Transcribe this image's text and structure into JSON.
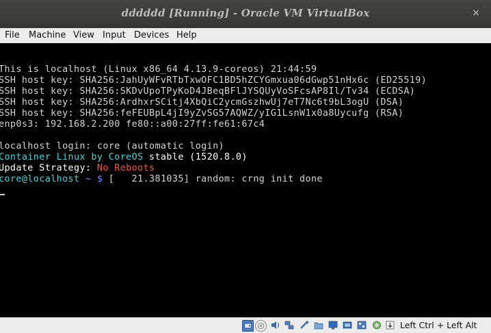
{
  "window": {
    "title": "dddddd [Running] - Oracle VM VirtualBox",
    "close_glyph": "×"
  },
  "menu": {
    "items": [
      "File",
      "Machine",
      "View",
      "Input",
      "Devices",
      "Help"
    ]
  },
  "console": {
    "l1": "This is localhost (Linux x86_64 4.13.9-coreos) 21:44:59",
    "l2": "SSH host key: SHA256:JahUyWFvRTbTxwOFC1BD5hZCYGmxua06dGwp51nHx6c (ED25519)",
    "l3": "SSH host key: SHA256:SKDvUpoTPyKoD4JBeqBFlJYSQUyVoSFcsAP8Il/Tv34 (ECDSA)",
    "l4": "SSH host key: SHA256:ArdhxrSCitj4XbQiC2ycmGszhwUj7eT7Nc6t9bL3ogU (DSA)",
    "l5": "SSH host key: SHA256:feFEUBpL4jI9yZvSG57AQWZ/yIG1LsnW1x0a8Uycufg (RSA)",
    "l6": "enp0s3: 192.168.2.200 fe80::a00:27ff:fe61:67c4",
    "l7": "localhost login: core (automatic login)",
    "l8a": "Container Linux by CoreOS",
    "l8b": " stable (1520.8.0)",
    "l9a": "Update Strategy: ",
    "l9b": "No Reboots",
    "l10a": "core@localhost",
    "l10b": " ~ ",
    "l10c": "$",
    "l10d": " [   21.381035] random: crng init done"
  },
  "statusbar": {
    "icons": [
      "hard-disk-icon",
      "optical-drive-icon",
      "audio-icon",
      "network-icon",
      "usb-icon",
      "shared-folders-icon",
      "display-icon",
      "video-capture-icon",
      "guest-additions-icon",
      "cpu-icon",
      "mouse-integration-icon"
    ],
    "host_key": "Left Ctrl + Left Alt"
  },
  "colors": {
    "titlebar": "#3b3b38",
    "console_bg": "#000000",
    "console_text": "#d4d4d4",
    "cyan": "#43d5da",
    "red": "#f05252",
    "prompt_blue": "#6f8cff"
  }
}
